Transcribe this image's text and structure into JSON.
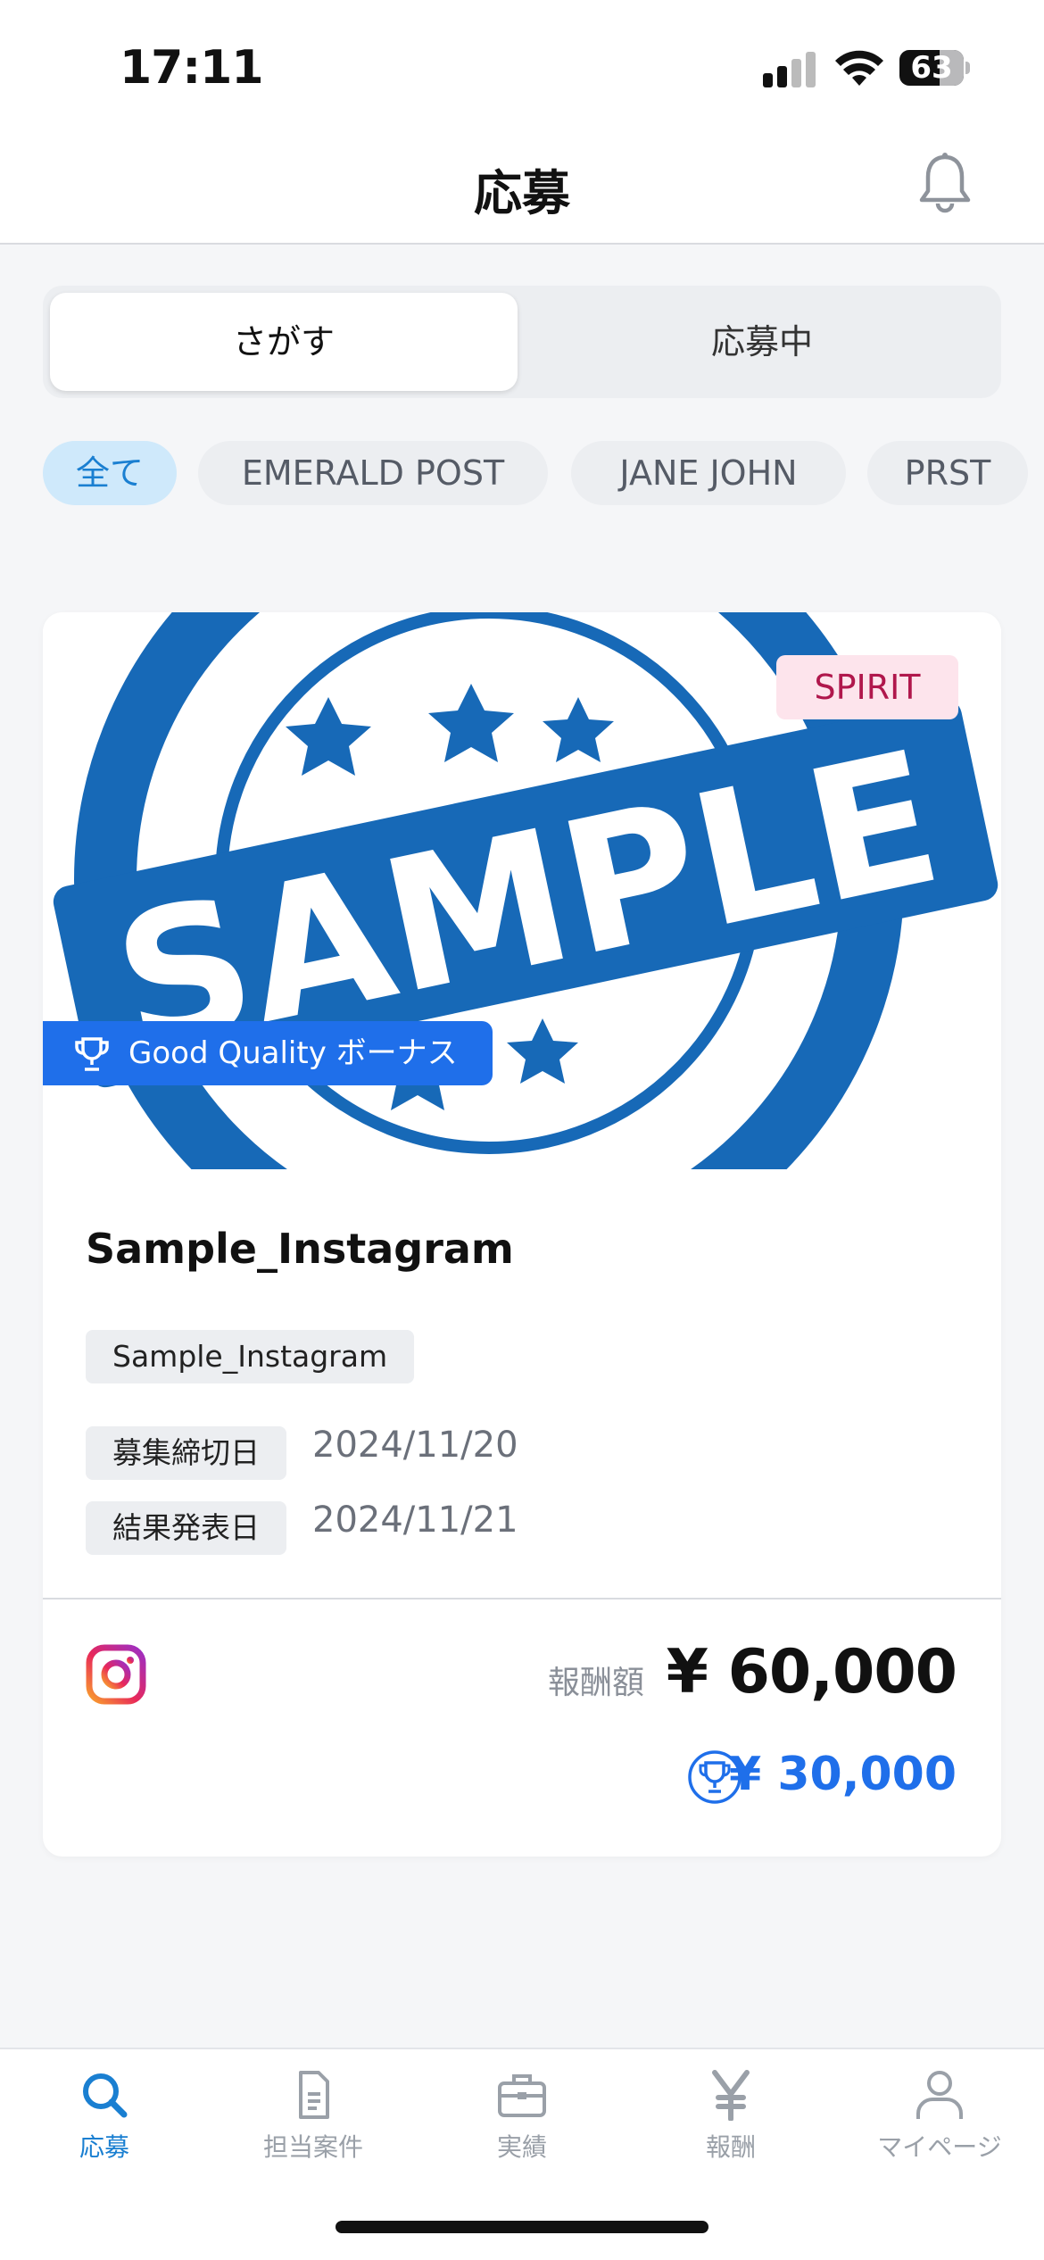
{
  "status_bar": {
    "time": "17:11",
    "battery_percent": "63",
    "battery_level": 0.63
  },
  "header": {
    "title": "応募",
    "bell_icon": "bell-icon"
  },
  "segmented": {
    "tabs": [
      "さがす",
      "応募中"
    ],
    "selected": "さがす"
  },
  "filters": {
    "chips": [
      "全て",
      "EMERALD POST",
      "JANE JOHN",
      "PRST"
    ],
    "selected": "全て"
  },
  "card": {
    "image_stamp_text": "SAMPLE",
    "brand_badge": "SPIRIT",
    "bonus_ribbon": "Good Quality ボーナス",
    "title": "Sample_Instagram",
    "tag": "Sample_Instagram",
    "deadline_label": "募集締切日",
    "deadline_value": "2024/11/20",
    "result_label": "結果発表日",
    "result_value": "2024/11/21",
    "platform_icon": "instagram-icon",
    "reward_label": "報酬額",
    "reward_amount": "¥ 60,000",
    "bonus_amount": "¥ 30,000"
  },
  "tabbar": {
    "items": [
      {
        "label": "応募",
        "icon": "search-icon"
      },
      {
        "label": "担当案件",
        "icon": "document-icon"
      },
      {
        "label": "実績",
        "icon": "briefcase-icon"
      },
      {
        "label": "報酬",
        "icon": "yen-icon"
      },
      {
        "label": "マイページ",
        "icon": "person-icon"
      }
    ],
    "selected": "応募"
  },
  "colors": {
    "accent_blue": "#1f6fea",
    "tab_active": "#1a7fd1",
    "chip_active_bg": "#cfe9fb",
    "stamp_blue": "#1769b7",
    "brand_badge_bg": "#fde4ec",
    "brand_badge_text": "#b0174c"
  }
}
